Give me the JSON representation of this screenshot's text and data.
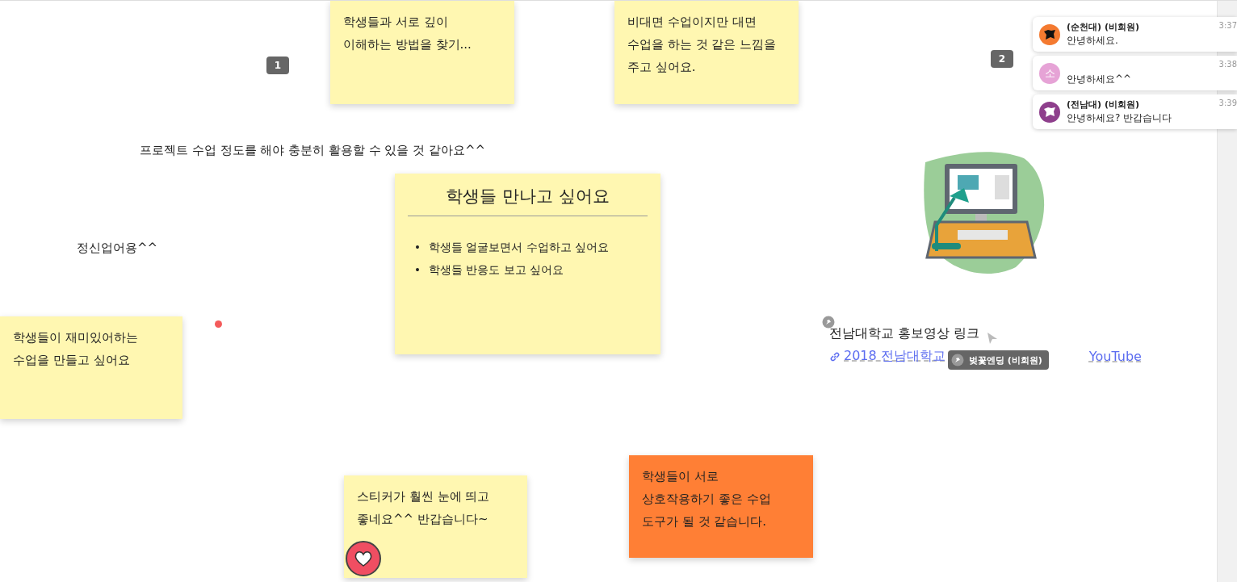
{
  "notes": [
    {
      "kind": "sticky",
      "color": "#fff7b1",
      "text": "학생들과 서로 깊이\n이해하는 방법을 찾기..."
    },
    {
      "kind": "sticky",
      "color": "#fff7b1",
      "text": "비대면 수업이지만 대면\n수업을 하는 것 같은 느낌을\n주고 싶어요."
    },
    {
      "kind": "text",
      "text": "프로젝트 수업 정도를 해야 충분히 활용할 수 있을 것 같아요^^"
    },
    {
      "kind": "text",
      "text": "정신업어용^^"
    },
    {
      "kind": "sticky",
      "color": "#fff7b1",
      "text": "학생들이 재미있어하는\n수업을 만들고 싶어요"
    },
    {
      "kind": "list",
      "color": "#fff7b1",
      "title": "학생들 만나고 싶어요",
      "marker": "•",
      "items": [
        "학생들 얼굴보면서 수업하고 싶어요",
        "학생들 반응도 보고 싶어요"
      ]
    },
    {
      "kind": "sticky",
      "color": "#fff7b1",
      "text": "스티커가 훨씬 눈에 띄고\n좋네요^^ 반갑습니다~",
      "liked": true
    },
    {
      "kind": "sticky",
      "color": "#ff7f35",
      "text": "학생들이 서로\n상호작용하기 좋은 수업\n도구가 될 것 같습니다."
    }
  ],
  "section_badges": [
    "1",
    "2"
  ],
  "link_card": {
    "title": "전남대학교 홍보영상 링크",
    "link_start": "2018 전남대학교",
    "link_end": "YouTube"
  },
  "cursor_tag": {
    "label": "벚꽃엔딩 (비회원)"
  },
  "chat": [
    {
      "kind": "icon",
      "color": "#f47a30",
      "name": "(순천대) (비회원)",
      "message": "안녕하세요.",
      "time": "3:37"
    },
    {
      "kind": "initial",
      "initial": "소",
      "color": "#e6a3d6",
      "message": "안녕하세요^^",
      "time": "3:38"
    },
    {
      "kind": "icon",
      "color": "#8e3f8c",
      "name": "(전남대) (비회원)",
      "message": "안녕하세요? 반갑습니다",
      "time": "3:39"
    }
  ]
}
